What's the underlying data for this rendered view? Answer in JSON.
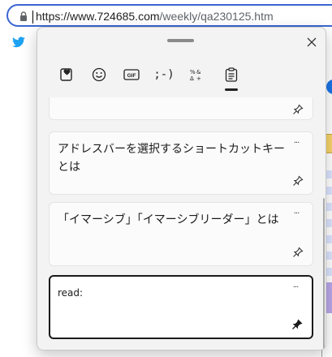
{
  "browser": {
    "url_host": "https://www.724685.com",
    "url_path": "/weekly/qa230125.htm"
  },
  "clipboard_panel": {
    "tabs": [
      {
        "name": "kaomoji-favorites",
        "icon": "heart-clipboard-icon"
      },
      {
        "name": "emoji",
        "icon": "smiley-icon"
      },
      {
        "name": "gif",
        "label": "GIF",
        "icon": "gif-icon"
      },
      {
        "name": "kaomoji",
        "label": ";-)",
        "icon": "kaomoji-icon"
      },
      {
        "name": "symbols",
        "icon": "symbols-icon"
      },
      {
        "name": "clipboard-history",
        "icon": "clipboard-icon",
        "active": true
      }
    ],
    "items": [
      {
        "text": "",
        "pinned": false
      },
      {
        "text": "アドレスバーを選択するショートカットキーとは",
        "pinned": false
      },
      {
        "text": "「イマーシブ」「イマーシブリーダー」とは",
        "pinned": false
      },
      {
        "text": "read:",
        "pinned": true,
        "selected": true
      }
    ],
    "more_label": "···"
  },
  "colors": {
    "address_border": "#3a66d1",
    "twitter": "#1da1f2",
    "selected_border": "#1b1b1b"
  }
}
